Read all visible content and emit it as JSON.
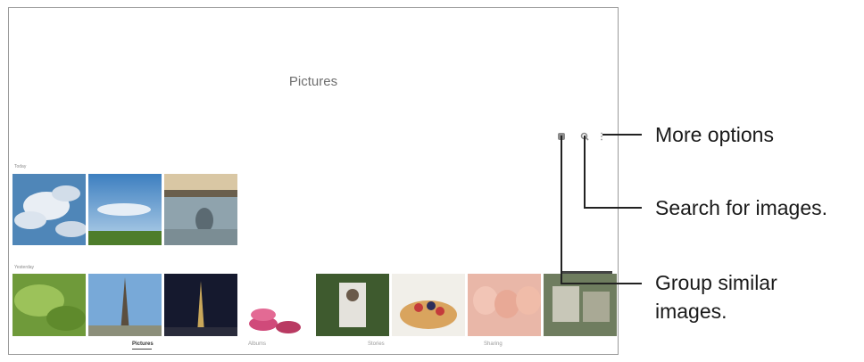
{
  "screen": {
    "title": "Pictures",
    "toolbar_icons": [
      "group-similar-icon",
      "search-icon",
      "more-options-icon"
    ],
    "groups": [
      {
        "label": "Today",
        "thumbnails": [
          "sky-clouds",
          "blue-sky-field",
          "lake-reflection"
        ]
      },
      {
        "label": "Yesterday",
        "thumbnails": [
          "green-leaves",
          "eiffel-tower-day",
          "eiffel-tower-night",
          "macarons-stack",
          "cat-photo",
          "fruit-tart",
          "pink-macarons",
          "cafe-scene"
        ]
      }
    ],
    "bottom_nav": [
      "Pictures",
      "Albums",
      "Stories",
      "Sharing"
    ]
  },
  "callouts": {
    "more_options": "More options",
    "search": "Search for images.",
    "group_line1": "Group similar",
    "group_line2": "images."
  }
}
